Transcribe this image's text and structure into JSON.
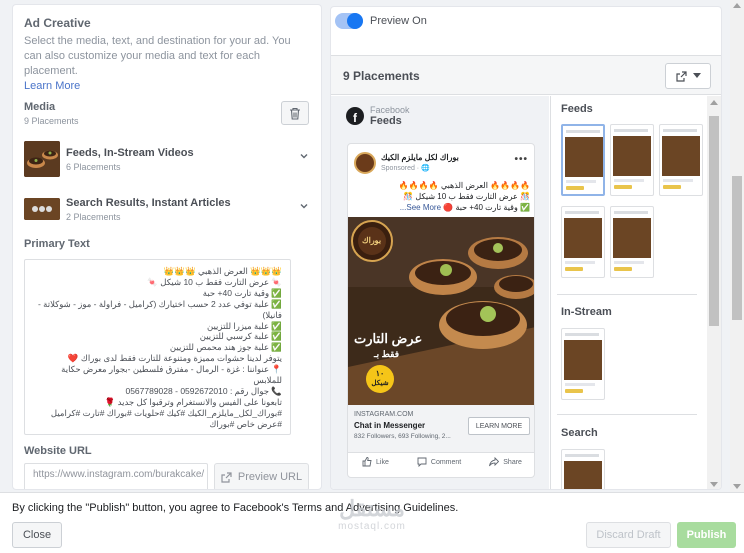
{
  "ad_creative": {
    "title": "Ad Creative",
    "description": "Select the media, text, and destination for your ad. You can also customize your media and text for each placement.",
    "learn_more": "Learn More"
  },
  "media": {
    "title": "Media",
    "count": "9 Placements",
    "items": [
      {
        "name": "Feeds, In-Stream Videos",
        "sub": "6 Placements"
      },
      {
        "name": "Search Results, Instant Articles",
        "sub": "2 Placements"
      }
    ]
  },
  "primary_text": {
    "label": "Primary Text",
    "value": "👑👑👑 العرض الذهبي 👑👑👑\n🍬 عرض التارت فقط ب 10 شيكل 🍬\n✅ وقية تارت 40+ حبة\n✅ علبة توفي عدد 2 حسب اختيارك (كراميل - فراولة - موز - شوكلاتة - فانيلا)\n✅ علبة ميزرا للتزيين\n✅ علبة كرسبي للتزيين\n✅ علبة جوز هند محمص للتزيين\nيتوفر لدينا حشوات مميزة ومتنوعة للتارت فقط لدى بوراك ❤️\n📍 عنواننا : غزة - الرمال - مفترق فلسطين -بجوار معرض حكاية للملابس\n📞 جوال رقم : 0592672010 - 0567789028\nتابعونا على الفيس والانستغرام وترقبوا كل جديد 🌹\n#بوراك_لكل_مايلزم_الكيك #كيك #حلويات #بوراك #تارت #كراميل #عرض خاص #بوراك"
  },
  "website": {
    "label": "Website URL",
    "value": "https://www.instagram.com/burakcake/",
    "preview_button": "Preview URL"
  },
  "preview": {
    "toggle_label": "Preview On",
    "placements_title": "9 Placements",
    "source_small": "Facebook",
    "source_big": "Feeds",
    "post": {
      "page_name": "بوراك لكل مايلزم الكيك",
      "sponsored": "Sponsored · 🌐",
      "line1": "🔥🔥🔥🔥 العرض الذهبي 🔥🔥🔥🔥",
      "line2": "🎊 عرض التارت فقط ب 10 شيكل 🎊",
      "line3": "✅ وقية تارت 40+ حبة 🔴",
      "see_more": "See More...",
      "image_title": "عرض التارت",
      "image_sub": "فقط بـ",
      "price": "١٠",
      "price_unit": "شيكل",
      "logo_text": "بوراك",
      "domain": "INSTAGRAM.COM",
      "cta_title": "Chat in Messenger",
      "cta_sub": "832 Followers, 693 Following, 2...",
      "cta_button": "LEARN MORE",
      "like": "Like",
      "comment": "Comment",
      "share": "Share"
    },
    "groups": [
      "Feeds",
      "In-Stream",
      "Search"
    ]
  },
  "footer": {
    "legal_prefix": "By clicking the \"Publish\" button, you agree to Facebook's ",
    "legal_terms": "Terms and Advertising Guidelines",
    "legal_suffix": ".",
    "close": "Close",
    "discard": "Discard Draft",
    "publish": "Publish",
    "watermark_ar": "مستقل",
    "watermark_en": "mostaql.com"
  },
  "colors": {
    "accent": "#1877f2",
    "publish": "#a8dc9e",
    "link": "#4a74c9"
  }
}
